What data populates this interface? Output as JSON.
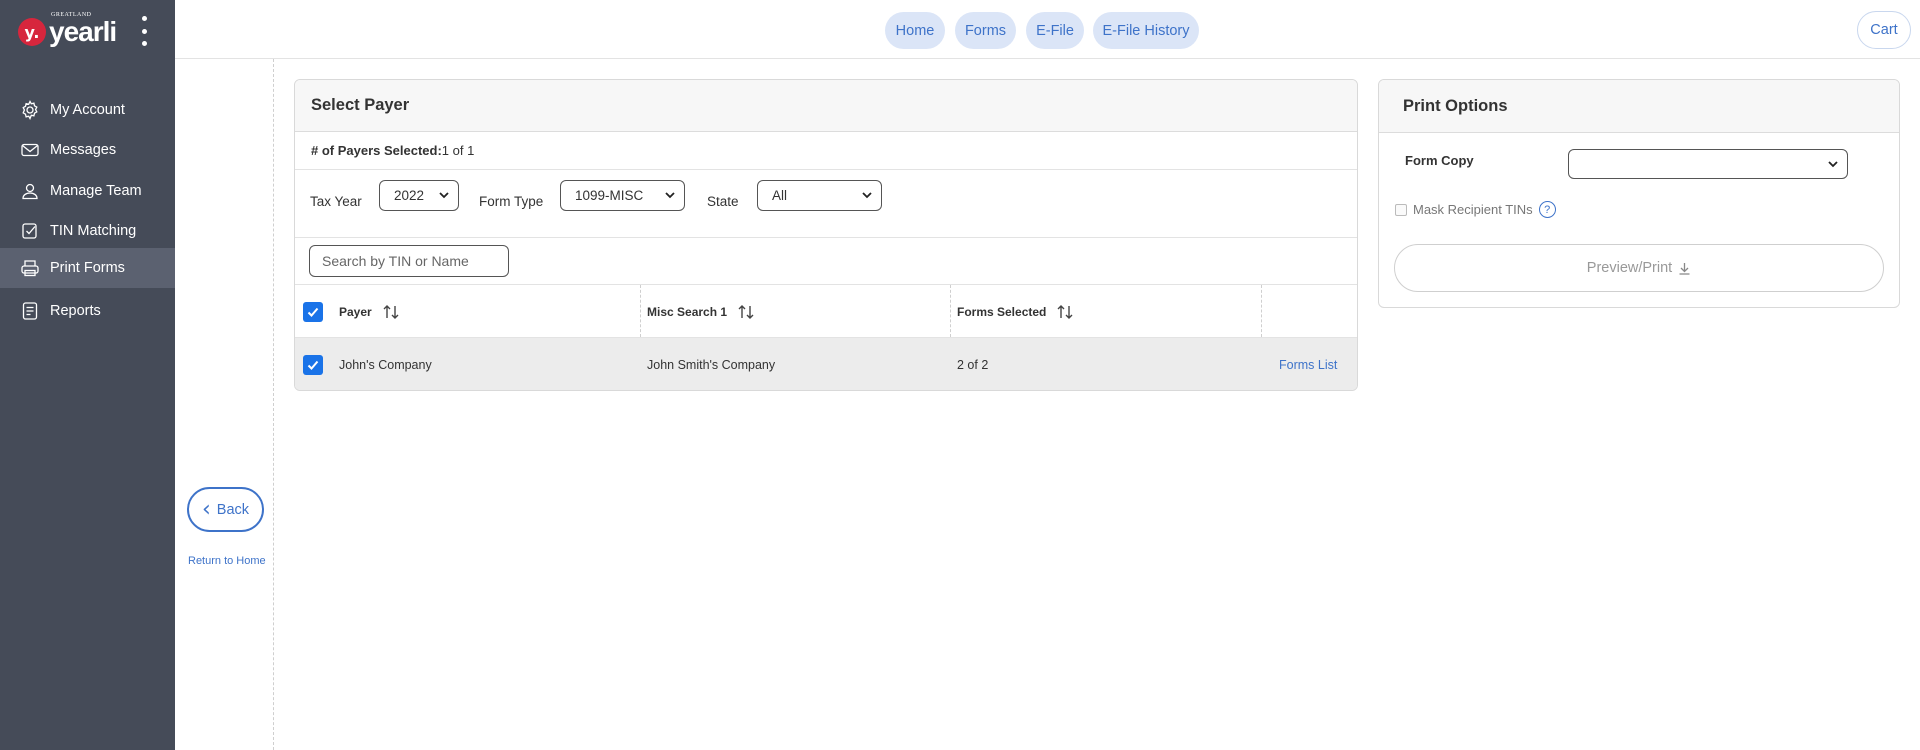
{
  "brand": {
    "small_text": "GREATLAND",
    "wordmark": "yearli",
    "mark": "y."
  },
  "sidebar": {
    "items": [
      {
        "label": "My Account",
        "icon": "gear-icon"
      },
      {
        "label": "Messages",
        "icon": "envelope-icon"
      },
      {
        "label": "Manage Team",
        "icon": "person-icon"
      },
      {
        "label": "TIN Matching",
        "icon": "checkmark-doc-icon"
      },
      {
        "label": "Print Forms",
        "icon": "printer-icon",
        "active": true
      },
      {
        "label": "Reports",
        "icon": "report-icon"
      }
    ]
  },
  "topnav": {
    "tabs": [
      "Home",
      "Forms",
      "E-File",
      "E-File History"
    ],
    "cart": "Cart"
  },
  "side_actions": {
    "back": "Back",
    "return_home": "Return to Home"
  },
  "select_payer": {
    "title": "Select Payer",
    "payers_selected_label": "# of Payers Selected:",
    "payers_selected_value": "1 of 1",
    "filters": {
      "tax_year_label": "Tax Year",
      "tax_year_value": "2022",
      "form_type_label": "Form Type",
      "form_type_value": "1099-MISC",
      "state_label": "State",
      "state_value": "All"
    },
    "search_placeholder": "Search by TIN or Name",
    "columns": [
      "Payer",
      "Misc Search 1",
      "Forms Selected"
    ],
    "rows": [
      {
        "payer": "John's Company",
        "misc": "John Smith's Company",
        "forms_selected": "2 of 2",
        "action": "Forms List",
        "checked": true
      }
    ]
  },
  "print_options": {
    "title": "Print Options",
    "form_copy_label": "Form Copy",
    "form_copy_value": "",
    "mask_label": "Mask Recipient TINs",
    "help": "?",
    "preview_button": "Preview/Print"
  },
  "colors": {
    "sidebar": "#454b58",
    "accent": "#3e73c9",
    "pill_bg": "#dbe5f7",
    "checkbox": "#1a73e8"
  }
}
